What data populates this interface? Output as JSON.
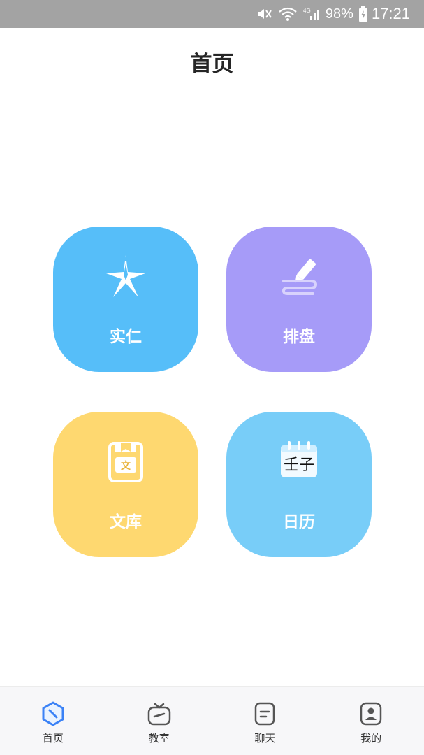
{
  "status_bar": {
    "battery": "98%",
    "time": "17:21",
    "icons": [
      "mute-icon",
      "wifi-icon",
      "signal-4g-icon",
      "battery-icon"
    ]
  },
  "header": {
    "title": "首页"
  },
  "tiles": [
    {
      "label": "实仁",
      "icon": "star-emblem-icon",
      "color": "#56bef9"
    },
    {
      "label": "排盘",
      "icon": "pencil-write-icon",
      "color": "#a69bf8"
    },
    {
      "label": "文库",
      "icon": "book-icon",
      "color": "#fed870",
      "icon_text": "文"
    },
    {
      "label": "日历",
      "icon": "calendar-icon",
      "color": "#78cdf8",
      "icon_text": "壬子"
    }
  ],
  "bottom_nav": {
    "items": [
      {
        "label": "首页",
        "icon": "home-compass-icon",
        "active": true
      },
      {
        "label": "教室",
        "icon": "tv-icon"
      },
      {
        "label": "聊天",
        "icon": "chat-icon"
      },
      {
        "label": "我的",
        "icon": "profile-icon"
      }
    ]
  },
  "colors": {
    "status_bar_bg": "#a3a3a3",
    "nav_active": "#3b82f6",
    "nav_inactive": "#555555"
  }
}
